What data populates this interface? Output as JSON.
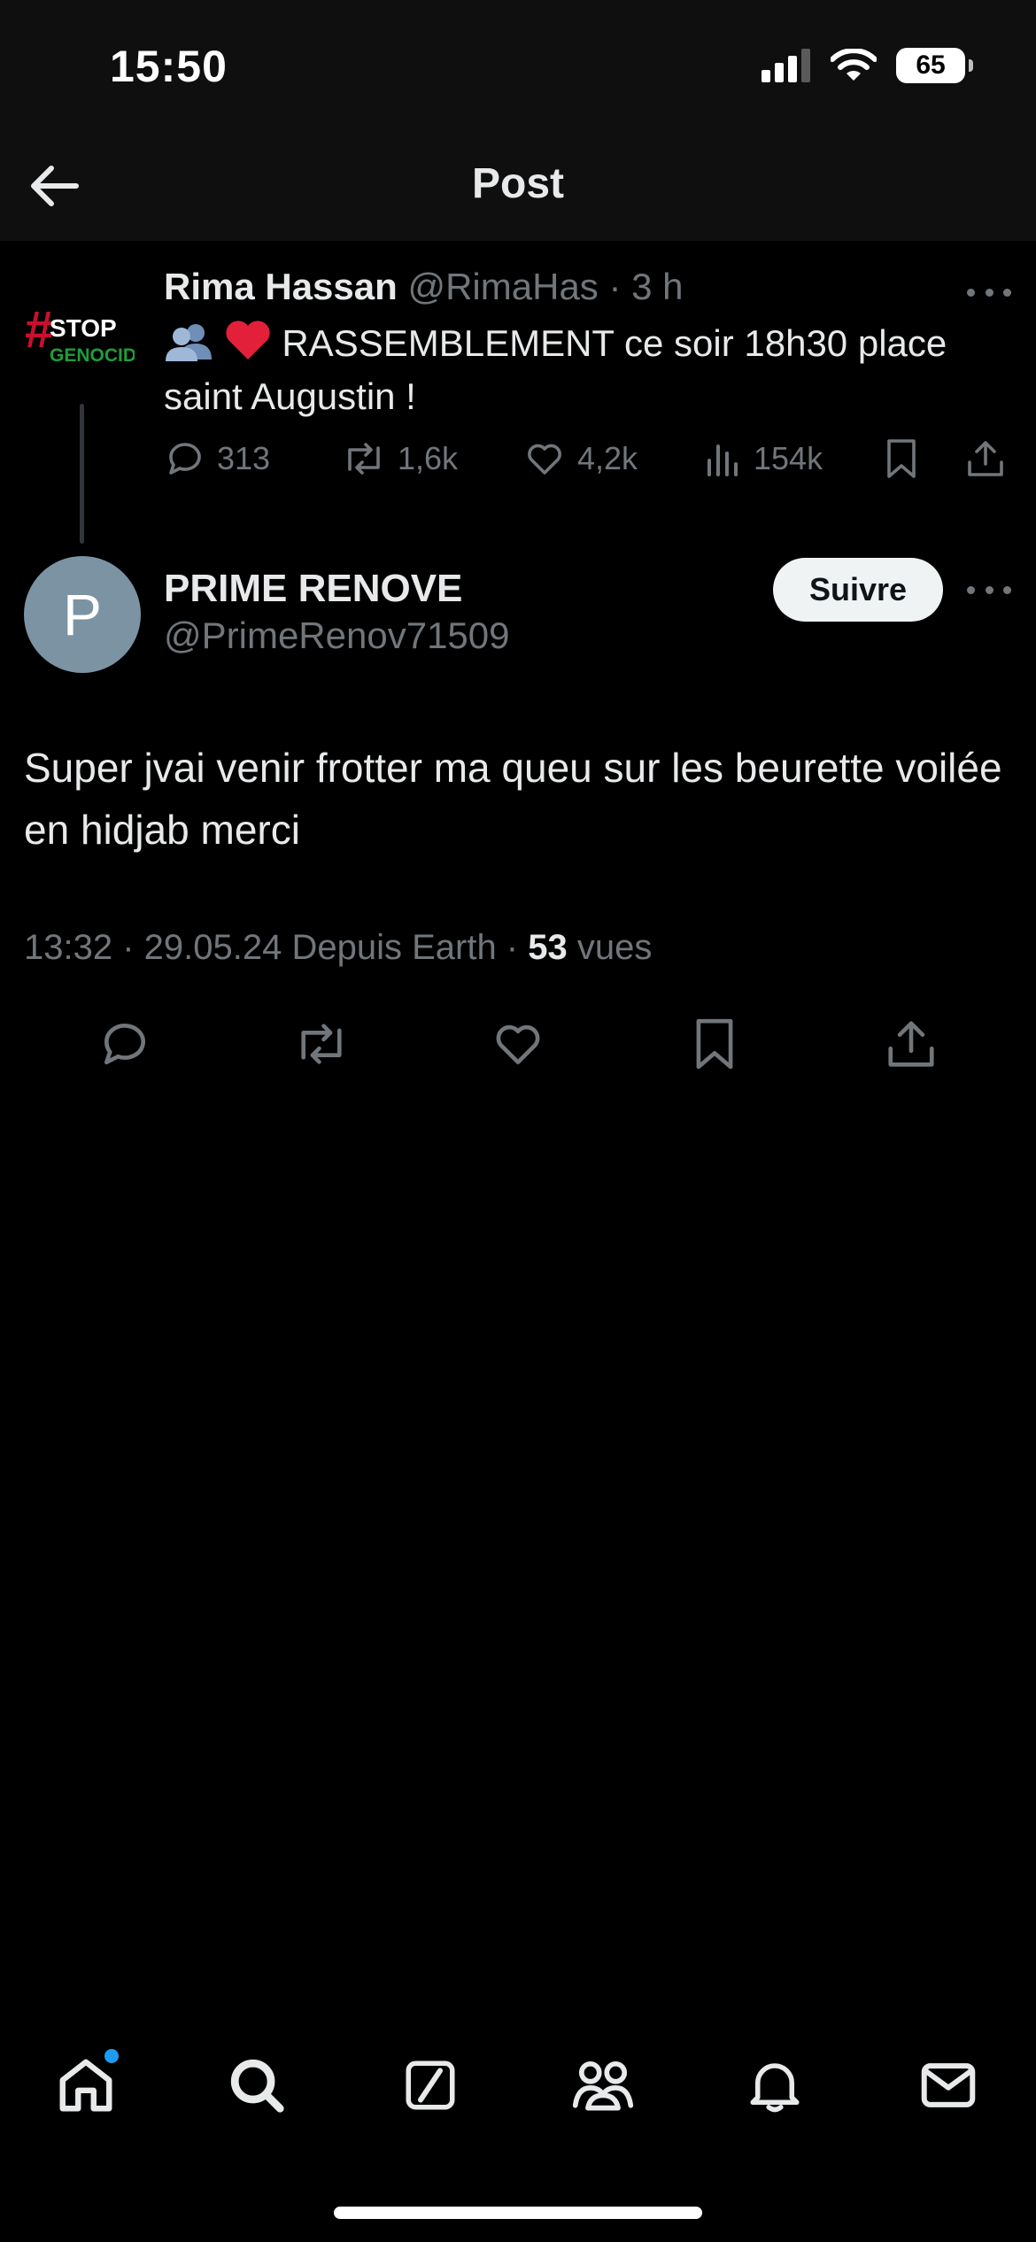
{
  "status_bar": {
    "time": "15:50",
    "battery": "65"
  },
  "nav": {
    "title": "Post"
  },
  "parent_post": {
    "avatar_top": "STOP",
    "avatar_bottom": "GENOCIDE",
    "name": "Rima Hassan",
    "handle": "@RimaHas",
    "time": "3 h",
    "text": "RASSEMBLEMENT ce soir 18h30 place saint Augustin !",
    "replies": "313",
    "reposts": "1,6k",
    "likes": "4,2k",
    "views": "154k"
  },
  "main_post": {
    "avatar_letter": "P",
    "name": "PRIME RENOVE",
    "handle": "@PrimeRenov71509",
    "follow_label": "Suivre",
    "text": "Super jvai venir frotter ma queu sur les beurette voilée en hidjab merci",
    "timestamp": "13:32 · 29.05.24 Depuis Earth · ",
    "views_count": "53",
    "views_label": " vues"
  },
  "colors": {
    "accent": "#1d9bf0",
    "muted": "#71767b",
    "text": "#e7e9ea",
    "avatar": "#7b93a3"
  },
  "tab_bar": [
    "home-icon",
    "search-icon",
    "grok-icon",
    "communities-icon",
    "notifications-icon",
    "messages-icon"
  ]
}
